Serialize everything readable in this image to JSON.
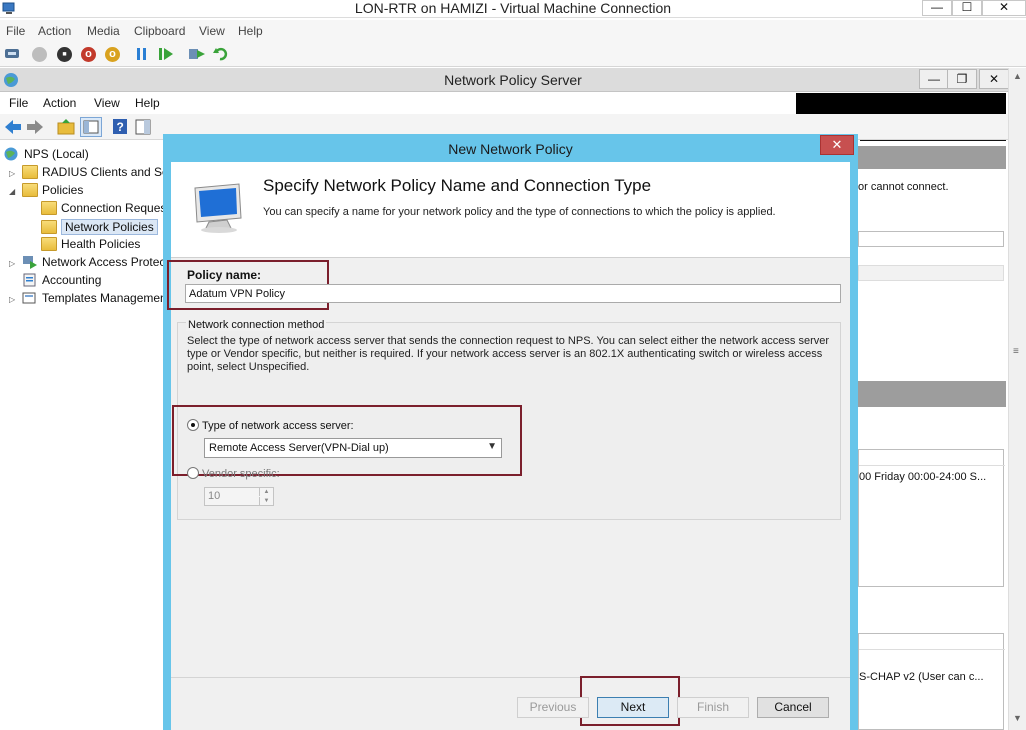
{
  "vm_window": {
    "title": "LON-RTR on HAMIZI - Virtual Machine Connection",
    "menu": [
      "File",
      "Action",
      "Media",
      "Clipboard",
      "View",
      "Help"
    ],
    "controls": {
      "minimize": "—",
      "maximize": "☐",
      "close": "✕"
    }
  },
  "nps_window": {
    "title": "Network Policy Server",
    "menu": [
      "File",
      "Action",
      "View",
      "Help"
    ],
    "controls": {
      "minimize": "—",
      "restore": "❐",
      "close": "✕"
    }
  },
  "tree": {
    "root": "NPS (Local)",
    "items": {
      "radius": "RADIUS Clients and Servers",
      "policies": "Policies",
      "connection_request": "Connection Request Policies",
      "network_policies": "Network Policies",
      "health_policies": "Health Policies",
      "nap": "Network Access Protection",
      "accounting": "Accounting",
      "templates": "Templates Management"
    }
  },
  "right_pane": {
    "text1": "or cannot connect.",
    "text2": "00 Friday 00:00-24:00 S...",
    "text3": "S-CHAP v2 (User can c..."
  },
  "dialog": {
    "title": "New Network Policy",
    "close": "✕",
    "header": {
      "title": "Specify Network Policy Name and Connection Type",
      "subtitle": "You can specify a name for your network policy and the type of connections to which the policy is applied."
    },
    "policy_name_label": "Policy name:",
    "policy_name_value": "Adatum VPN Policy",
    "group_label": "Network connection method",
    "group_desc": "Select the type of network access server that sends the connection request to NPS. You can select either the network access server type or Vendor specific, but neither is required.  If your network access server is an 802.1X authenticating switch or wireless access point, select Unspecified.",
    "radio_type_label": "Type of network access server:",
    "radio_type_value": "Remote Access Server(VPN-Dial up)",
    "radio_vendor_label": "Vendor specific:",
    "vendor_value": "10",
    "buttons": {
      "previous": "Previous",
      "next": "Next",
      "finish": "Finish",
      "cancel": "Cancel"
    }
  },
  "colors": {
    "dialog_frame": "#67c5ea",
    "highlight_box": "#7b1f2c",
    "close_button": "#c75050"
  }
}
